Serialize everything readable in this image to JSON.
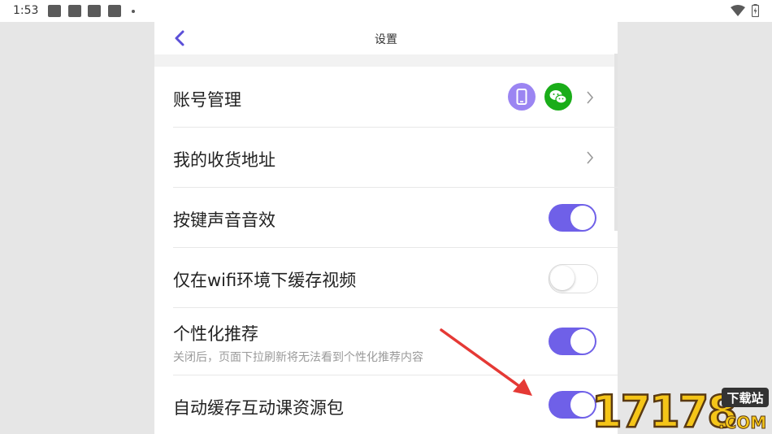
{
  "status_bar": {
    "time": "1:53"
  },
  "header": {
    "title": "设置"
  },
  "settings": {
    "account": {
      "label": "账号管理"
    },
    "address": {
      "label": "我的收货地址"
    },
    "key_sound": {
      "label": "按键声音音效",
      "enabled": true
    },
    "wifi_cache": {
      "label": "仅在wifi环境下缓存视频",
      "enabled": false
    },
    "personalized": {
      "label": "个性化推荐",
      "subtitle": "关闭后，页面下拉刷新将无法看到个性化推荐内容",
      "enabled": true
    },
    "auto_cache": {
      "label": "自动缓存互动课资源包",
      "enabled": true
    }
  },
  "watermark": {
    "number": "17178",
    "badge": "下载站",
    "suffix": ".COM"
  },
  "colors": {
    "accent": "#6f60e8",
    "phone_icon_bg": "#9b85f2",
    "wechat_bg": "#1aad19",
    "arrow": "#e53935"
  }
}
